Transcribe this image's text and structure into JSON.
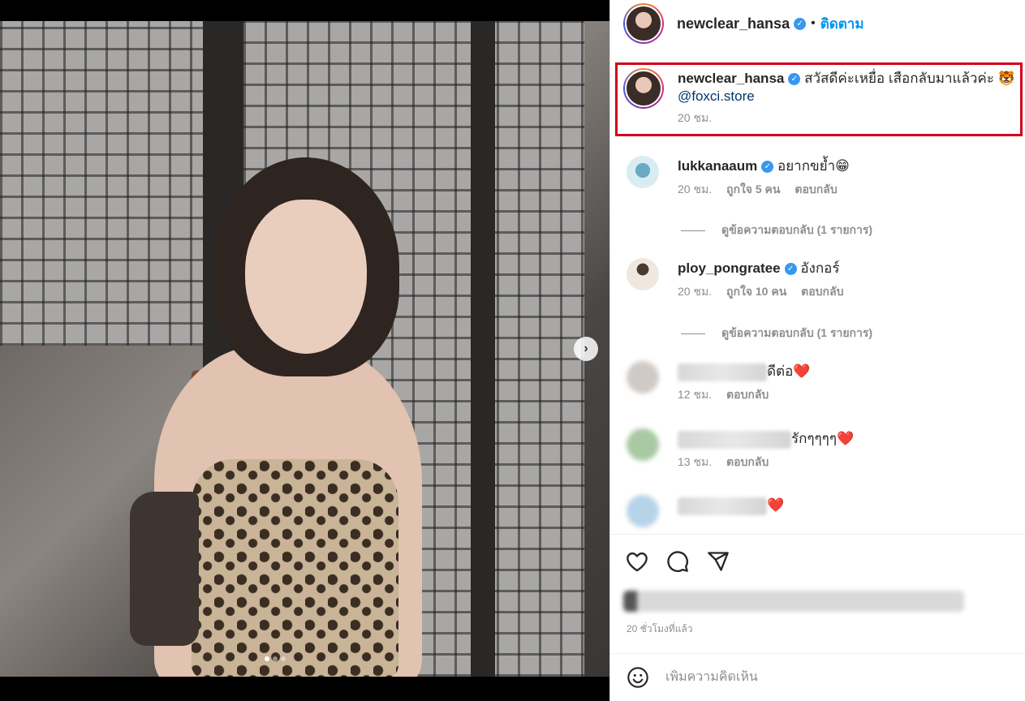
{
  "post": {
    "author": "newclear_hansa",
    "follow_label": "ติดตาม",
    "separator": "•",
    "carousel": {
      "total_slides": 3,
      "active_slide": 1
    }
  },
  "caption": {
    "username": "newclear_hansa",
    "text": "สวัสดีค่ะเหยื่อ เสือกลับมาแล้วค่ะ 🐯",
    "mention": "@foxci.store",
    "time": "20 ชม."
  },
  "comments": [
    {
      "username": "lukkanaaum",
      "text": "อยากขย้ำ😁",
      "time": "20 ชม.",
      "likes": "ถูกใจ 5 คน",
      "reply": "ตอบกลับ",
      "view_replies": "ดูข้อความตอบกลับ (1 รายการ)"
    },
    {
      "username": "ploy_pongratee",
      "text": "อังกอร์",
      "time": "20 ชม.",
      "likes": "ถูกใจ 10 คน",
      "reply": "ตอบกลับ",
      "view_replies": "ดูข้อความตอบกลับ (1 รายการ)"
    },
    {
      "text": "ดีต่อ❤️",
      "time": "12 ชม.",
      "reply": "ตอบกลับ"
    },
    {
      "text": "รักๆๆๆๆ❤️",
      "time": "13 ชม.",
      "reply": "ตอบกลับ"
    },
    {
      "text": "❤️"
    }
  ],
  "post_time": "20 ชั่วโมงที่แล้ว",
  "add_comment_placeholder": "เพิ่มความคิดเห็น",
  "icons": {
    "next": "chevron-right-icon",
    "like": "heart-icon",
    "comment": "comment-icon",
    "share": "paper-plane-icon",
    "emoji": "smiley-icon",
    "verified": "verified-badge-icon"
  },
  "colors": {
    "accent": "#0095f6",
    "highlight_box": "#d0021b",
    "verified": "#3897f0"
  }
}
